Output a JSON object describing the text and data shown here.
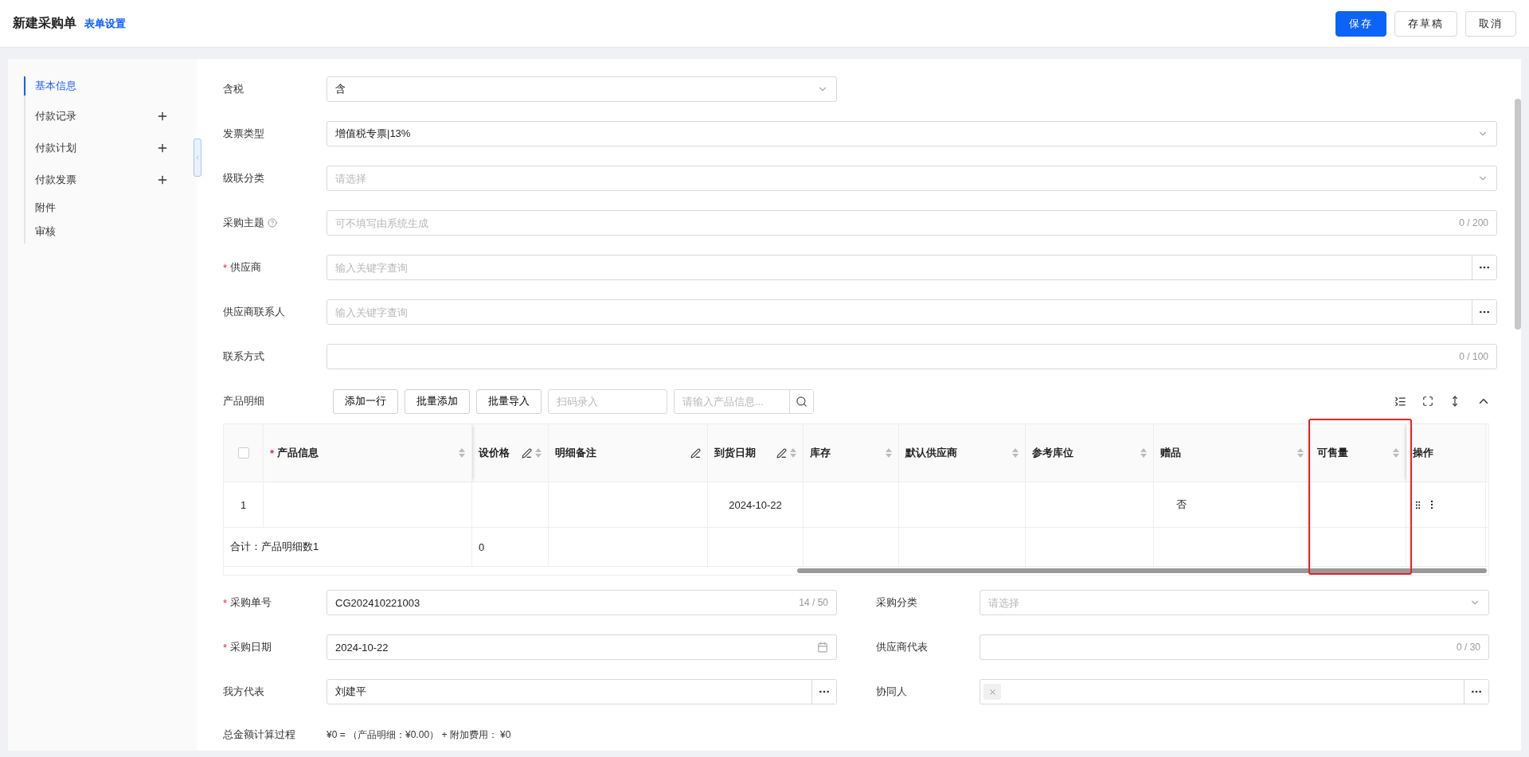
{
  "header": {
    "title": "新建采购单",
    "settings_link": "表单设置",
    "buttons": [
      {
        "label": "保存",
        "kind": "primary"
      },
      {
        "label": "存草稿",
        "kind": "default"
      },
      {
        "label": "取消",
        "kind": "default"
      }
    ]
  },
  "sidebar": {
    "items": [
      {
        "label": "基本信息",
        "selected": true,
        "addable": false
      },
      {
        "label": "付款记录",
        "selected": false,
        "addable": true
      },
      {
        "label": "付款计划",
        "selected": false,
        "addable": true
      },
      {
        "label": "付款发票",
        "selected": false,
        "addable": true
      },
      {
        "label": "附件",
        "selected": false,
        "addable": false
      },
      {
        "label": "审核",
        "selected": false,
        "addable": false
      }
    ]
  },
  "form_top": [
    {
      "label": "含税",
      "kind": "select",
      "value": "含",
      "narrow": true
    },
    {
      "label": "发票类型",
      "kind": "select",
      "value": "增值税专票|13%"
    },
    {
      "label": "级联分类",
      "kind": "select",
      "placeholder": "请选择"
    },
    {
      "label": "采购主题",
      "kind": "text",
      "placeholder": "可不填写由系统生成",
      "counter": "0 / 200",
      "help": true
    },
    {
      "label": "供应商",
      "kind": "lookup",
      "placeholder": "输入关键字查询",
      "mark": "*"
    },
    {
      "label": "供应商联系人",
      "kind": "lookup",
      "placeholder": "输入关键字查询"
    },
    {
      "label": "联系方式",
      "kind": "text",
      "counter": "0 / 100"
    }
  ],
  "product_section": {
    "label": "产品明细",
    "buttons": [
      "添加一行",
      "批量添加",
      "批量导入"
    ],
    "scan_placeholder": "扫码录入",
    "search_placeholder": "请输入产品信息...",
    "table": {
      "header_checked": false,
      "columns": [
        {
          "title": "产品信息",
          "mark": "*",
          "editable": false,
          "sortable": true,
          "highlighted": false
        },
        {
          "title": "设价格",
          "editable": true,
          "sortable": true,
          "highlighted": false
        },
        {
          "title": "明细备注",
          "editable": true,
          "sortable": false,
          "highlighted": false
        },
        {
          "title": "到货日期",
          "editable": true,
          "sortable": true,
          "highlighted": false
        },
        {
          "title": "库存",
          "editable": false,
          "sortable": true,
          "highlighted": false
        },
        {
          "title": "默认供应商",
          "editable": false,
          "sortable": true,
          "highlighted": false
        },
        {
          "title": "参考库位",
          "editable": false,
          "sortable": true,
          "highlighted": false
        },
        {
          "title": "赠品",
          "editable": false,
          "sortable": true,
          "highlighted": false
        },
        {
          "title": "可售量",
          "editable": false,
          "sortable": true,
          "highlighted": true
        },
        {
          "title": "操作",
          "editable": false,
          "sortable": false,
          "highlighted": false
        }
      ],
      "rows": [
        {
          "index": "1",
          "cells": [
            null,
            null,
            null,
            "2024-10-22",
            null,
            null,
            null,
            "否",
            null,
            null
          ]
        }
      ],
      "summary": {
        "label": "合计：产品明细数1",
        "cells": [
          "0",
          null,
          null,
          null,
          null,
          null,
          null,
          null,
          null
        ]
      }
    }
  },
  "form_bottom": {
    "left": [
      {
        "label": "采购单号",
        "kind": "text",
        "value": "CG202410221003",
        "counter": "14 / 50",
        "mark": "*"
      },
      {
        "label": "采购日期",
        "kind": "date",
        "value": "2024-10-22",
        "mark": "*"
      },
      {
        "label": "我方代表",
        "kind": "lookup",
        "value": "刘建平"
      }
    ],
    "right": [
      {
        "label": "采购分类",
        "kind": "select",
        "placeholder": "请选择"
      },
      {
        "label": "供应商代表",
        "kind": "text",
        "counter": "0 / 30"
      },
      {
        "label": "协同人",
        "kind": "tags",
        "tags": [
          {
            "removable": true
          }
        ]
      }
    ]
  },
  "total": {
    "label": "总金额计算过程",
    "text": "¥0 = （产品明细：¥0.00） + 附加费用： ¥0"
  }
}
